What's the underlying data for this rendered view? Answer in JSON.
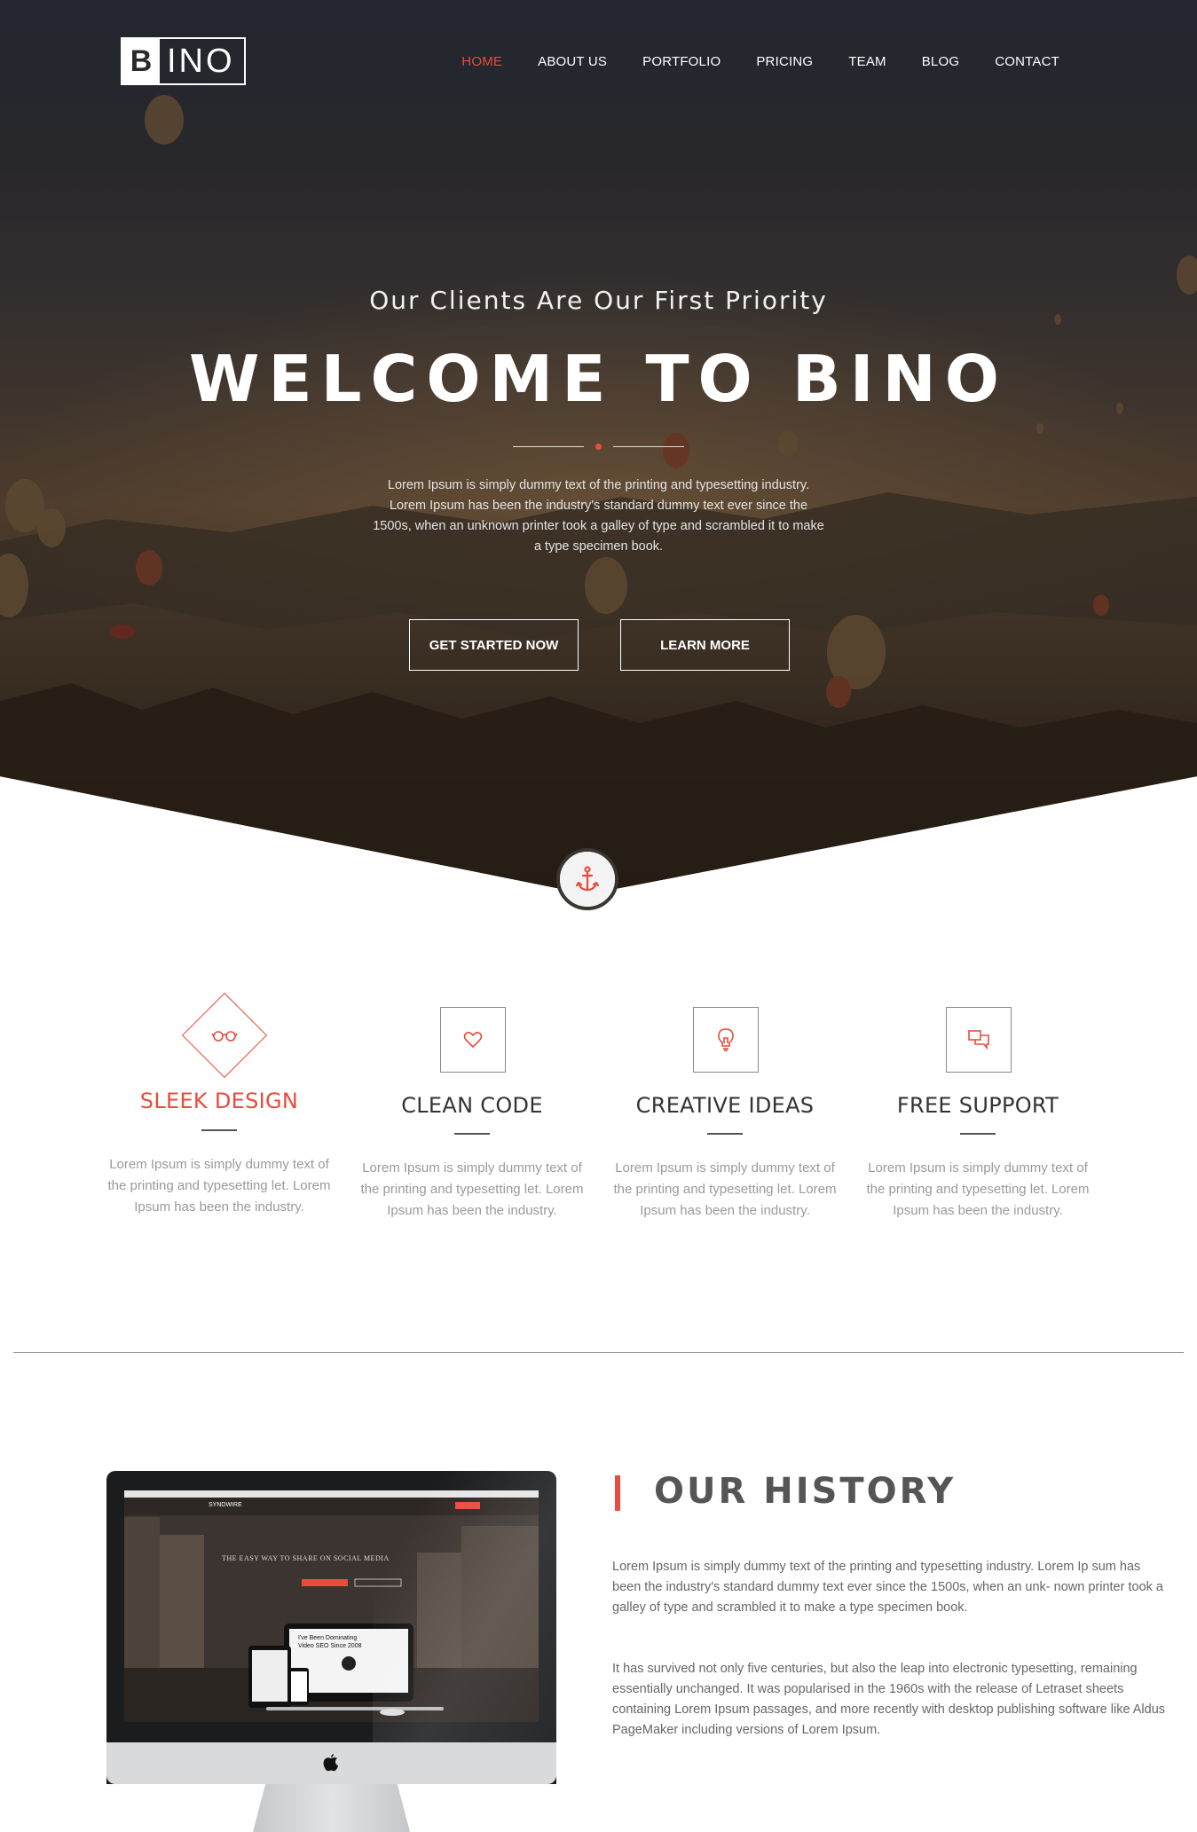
{
  "brand": {
    "logo_letter": "B",
    "logo_rest": "INO"
  },
  "nav": {
    "items": [
      {
        "label": "HOME",
        "active": true
      },
      {
        "label": "ABOUT US"
      },
      {
        "label": "PORTFOLIO"
      },
      {
        "label": "PRICING"
      },
      {
        "label": "TEAM"
      },
      {
        "label": "BLOG"
      },
      {
        "label": "CONTACT"
      }
    ]
  },
  "hero": {
    "subtitle": "Our Clients Are Our First Priority",
    "title": "WELCOME TO BINO",
    "text": "Lorem Ipsum is simply dummy text of the printing and typesetting industry. Lorem Ipsum has been the industry's standard dummy text ever since the 1500s, when an unknown printer took a galley of type and scrambled it to make a type specimen book.",
    "btn_primary": "GET STARTED NOW",
    "btn_secondary": "LEARN MORE"
  },
  "features": [
    {
      "icon": "glasses-icon",
      "title": "SLEEK DESIGN",
      "text": "Lorem Ipsum is simply dummy text of the printing and typesetting let. Lorem Ipsum has been the industry."
    },
    {
      "icon": "heart-icon",
      "title": "CLEAN CODE",
      "text": "Lorem Ipsum is simply dummy text of the printing and typesetting let. Lorem Ipsum has been the industry."
    },
    {
      "icon": "lightbulb-icon",
      "title": "CREATIVE IDEAS",
      "text": "Lorem Ipsum is simply dummy text of the printing and typesetting let. Lorem Ipsum has been the industry."
    },
    {
      "icon": "chat-icon",
      "title": "FREE SUPPORT",
      "text": "Lorem Ipsum is simply dummy text of the printing and typesetting let. Lorem Ipsum has been the industry."
    }
  ],
  "history": {
    "title": "OUR HISTORY",
    "p1": "Lorem Ipsum is simply dummy text of the printing and typesetting industry. Lorem Ip sum has been the industry's standard dummy text ever since the 1500s, when an unk- nown printer took a galley of type and scrambled it to make a type specimen book.",
    "p2": "It has survived not only five centuries, but also the leap into electronic typesetting, remaining essentially unchanged. It was popularised in the 1960s with the release of Letraset sheets containing Lorem Ipsum passages, and more recently with desktop publishing software like Aldus PageMaker including versions of Lorem Ipsum."
  },
  "mockup": {
    "brand": "SYNDWIRE",
    "headline": "THE EASY WAY TO SHARE ON SOCIAL MEDIA",
    "video_text": "I've Been Dominating Video SEO Since 2008"
  },
  "colors": {
    "accent": "#e74c3c",
    "text": "#555555",
    "muted": "#9a9a9a"
  }
}
